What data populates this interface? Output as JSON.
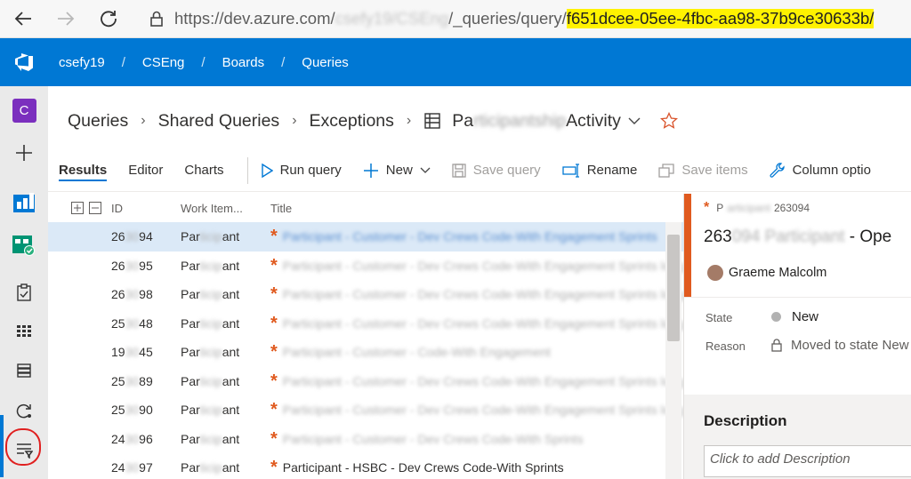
{
  "browser": {
    "url_prefix": "https://dev.azure.com/",
    "url_blurred": "csefy19/CSEng",
    "url_path": "/_queries/query/",
    "url_highlight": "f651dcee-05ee-4fbc-aa98-37b9ce30633b/"
  },
  "header": {
    "org": "csefy19",
    "project": "CSEng",
    "section": "Boards",
    "page": "Queries",
    "sep": "/"
  },
  "rail": {
    "project_initial": "C"
  },
  "page": {
    "crumbs": [
      "Queries",
      "Shared Queries",
      "Exceptions"
    ],
    "query_prefix": "Pa",
    "query_blurred": "rticipantship",
    "query_suffix": "Activity"
  },
  "toolbar": {
    "tabs": [
      "Results",
      "Editor",
      "Charts"
    ],
    "run": "Run query",
    "new": "New",
    "save": "Save query",
    "rename": "Rename",
    "save_items": "Save items",
    "column_options": "Column optio"
  },
  "grid": {
    "headers": {
      "id": "ID",
      "type": "Work Item...",
      "title": "Title"
    },
    "rows": [
      {
        "id_a": "26",
        "id_b": "94",
        "type_a": "Par",
        "type_b": "ant",
        "title": "Participant - Customer - Dev Crews Code-With Engagement Sprints"
      },
      {
        "id_a": "26",
        "id_b": "95",
        "type_a": "Par",
        "type_b": "ant",
        "title": "Participant - Customer - Dev Crews Code-With Engagement Sprints long"
      },
      {
        "id_a": "26",
        "id_b": "98",
        "type_a": "Par",
        "type_b": "ant",
        "title": "Participant - Customer - Dev Crews Code-With Engagement Sprints long"
      },
      {
        "id_a": "25",
        "id_b": "48",
        "type_a": "Par",
        "type_b": "ant",
        "title": "Participant - Customer - Dev Crews Code-With Engagement Sprints long"
      },
      {
        "id_a": "19",
        "id_b": "45",
        "type_a": "Par",
        "type_b": "ant",
        "title": "Participant - Customer - Code-With Engagement"
      },
      {
        "id_a": "25",
        "id_b": "89",
        "type_a": "Par",
        "type_b": "ant",
        "title": "Participant - Customer - Dev Crews Code-With Engagement Sprints long"
      },
      {
        "id_a": "25",
        "id_b": "90",
        "type_a": "Par",
        "type_b": "ant",
        "title": "Participant - Customer - Dev Crews Code-With Engagement Sprints long"
      },
      {
        "id_a": "24",
        "id_b": "96",
        "type_a": "Par",
        "type_b": "ant",
        "title": "Participant - Customer - Dev Crews Code-With Sprints"
      },
      {
        "id_a": "24",
        "id_b": "97",
        "type_a": "Par",
        "type_b": "ant",
        "title": "Participant - HSBC - Dev Crews Code-With Sprints"
      }
    ]
  },
  "panel": {
    "id_prefix": "P",
    "id_suffix": "263094",
    "title_prefix": "263",
    "title_suffix": "- Ope",
    "user": "Graeme Malcolm",
    "state_label": "State",
    "state_value": "New",
    "reason_label": "Reason",
    "reason_value": "Moved to state New",
    "description_title": "Description",
    "description_placeholder": "Click to add Description"
  }
}
